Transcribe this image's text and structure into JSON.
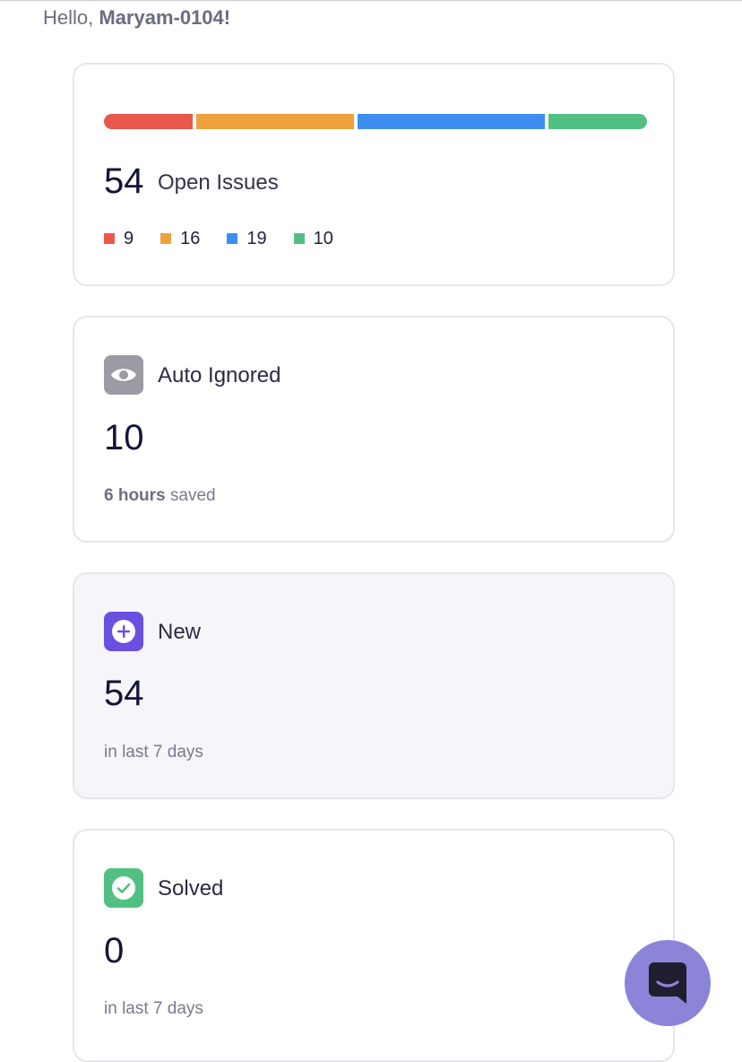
{
  "header": {
    "greeting_prefix": "Hello, ",
    "user_name": "Maryam-0104!"
  },
  "open_issues": {
    "count": "54",
    "label": "Open Issues",
    "breakdown": [
      {
        "value": "9",
        "color": "#e9584a"
      },
      {
        "value": "16",
        "color": "#f0a03c"
      },
      {
        "value": "19",
        "color": "#3d8ef0"
      },
      {
        "value": "10",
        "color": "#52c082"
      }
    ]
  },
  "auto_ignored": {
    "title": "Auto Ignored",
    "icon": "eye-icon",
    "icon_color": "#9b9ba4",
    "value": "10",
    "sub_strong": "6 hours",
    "sub_rest": " saved"
  },
  "new": {
    "title": "New",
    "icon": "plus-circle-icon",
    "icon_color": "#6b4fe0",
    "value": "54",
    "sub": "in last 7 days"
  },
  "solved": {
    "title": "Solved",
    "icon": "check-circle-icon",
    "icon_color": "#52c082",
    "value": "0",
    "sub": "in last 7 days"
  },
  "chat": {
    "icon": "chat-icon",
    "color": "#8b84d9"
  }
}
